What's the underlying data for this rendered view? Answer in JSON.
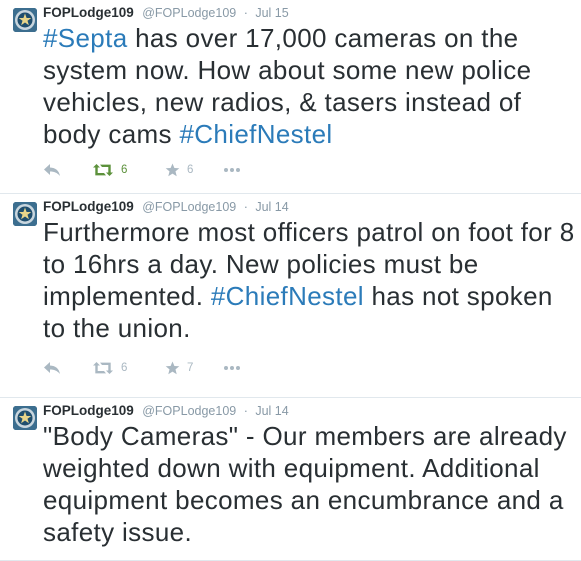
{
  "colors": {
    "text": "#292f33",
    "muted": "#8899a6",
    "hashtag": "#2b7bb9",
    "action_gray": "#aab8c2",
    "retweet_green": "#5c913b",
    "divider": "#e1e8ed"
  },
  "tweets": [
    {
      "fullname": "FOPLodge109",
      "username": "@FOPLodge109",
      "separator": "·",
      "time": "Jul 15",
      "text_parts": [
        "",
        "#Septa",
        " has over 17,000 cameras on the system now. How about some new police vehicles, new radios, & tasers instead of body cams ",
        "#ChiefNestel",
        ""
      ],
      "retweets": "6",
      "retweeted": true,
      "favorites": "6"
    },
    {
      "fullname": "FOPLodge109",
      "username": "@FOPLodge109",
      "separator": "·",
      "time": "Jul 14",
      "text_parts": [
        "Furthermore most officers patrol on foot for 8 to 16hrs a day. New policies must be implemented. ",
        "#ChiefNestel",
        " has not spoken to the union."
      ],
      "retweets": "6",
      "retweeted": false,
      "favorites": "7"
    },
    {
      "fullname": "FOPLodge109",
      "username": "@FOPLodge109",
      "separator": "·",
      "time": "Jul 14",
      "text_parts": [
        "\"Body Cameras\" - Our members are already weighted down with equipment. Additional equipment becomes an encumbrance and a safety issue."
      ]
    }
  ],
  "icons": {
    "avatar": "police-badge-avatar",
    "reply": "reply-icon",
    "retweet": "retweet-icon",
    "favorite": "star-icon",
    "more": "more-dots-icon"
  }
}
